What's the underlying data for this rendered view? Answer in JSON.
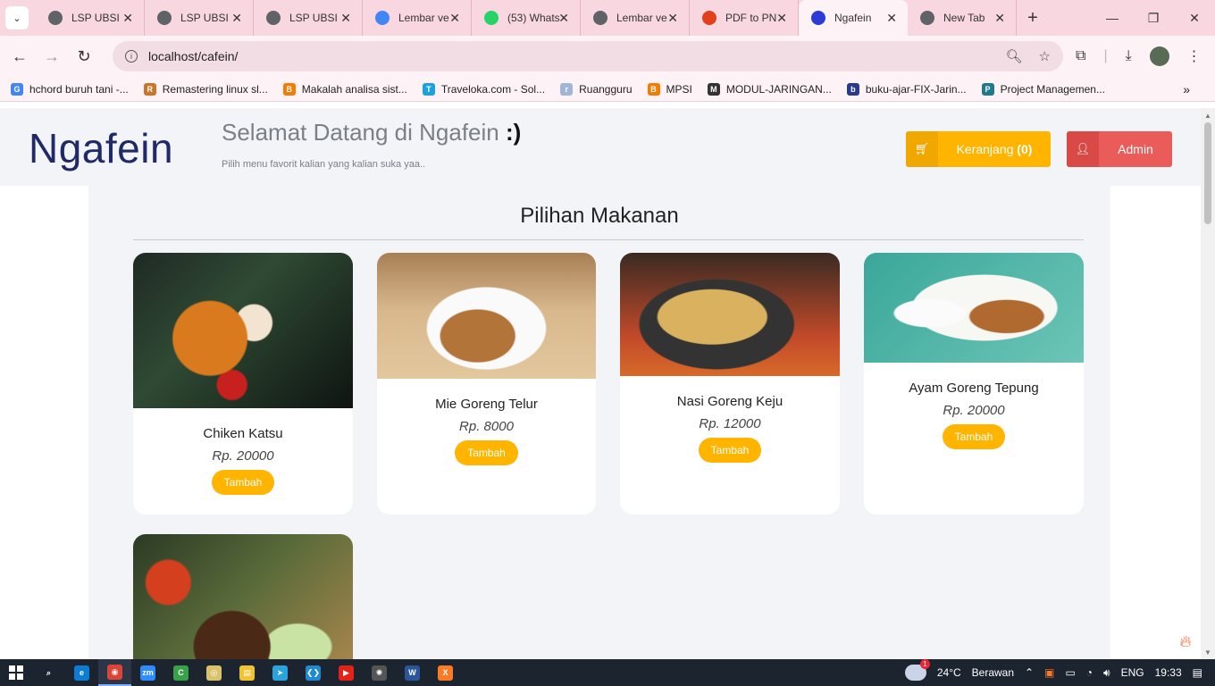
{
  "browser": {
    "tabs": [
      {
        "title": "LSP UBSI",
        "icon": "globe-icon",
        "color": "#5f6368"
      },
      {
        "title": "LSP UBSI",
        "icon": "globe-icon",
        "color": "#5f6368"
      },
      {
        "title": "LSP UBSI",
        "icon": "globe-icon",
        "color": "#5f6368"
      },
      {
        "title": "Lembar ve",
        "icon": "docs-icon",
        "color": "#4285f4"
      },
      {
        "title": "(53) Whats",
        "icon": "whatsapp-icon",
        "color": "#25d366"
      },
      {
        "title": "Lembar ve",
        "icon": "globe-icon",
        "color": "#5f6368"
      },
      {
        "title": "PDF to PN",
        "icon": "pdf-icon",
        "color": "#e2401c"
      },
      {
        "title": "Ngafein",
        "icon": "bootstrap-icon",
        "color": "#2a3bd8",
        "active": true
      },
      {
        "title": "New Tab",
        "icon": "chrome-icon",
        "color": "#5f6368"
      }
    ],
    "url": "localhost/cafein/",
    "bookmarks": [
      {
        "label": "hchord buruh tani -...",
        "color": "#4285f4",
        "glyph": "G"
      },
      {
        "label": "Remastering linux sl...",
        "color": "#c9762a",
        "glyph": "R"
      },
      {
        "label": "Makalah analisa sist...",
        "color": "#f57c00",
        "glyph": "B"
      },
      {
        "label": "Traveloka.com - Sol...",
        "color": "#1ba0e2",
        "glyph": "T"
      },
      {
        "label": "Ruangguru",
        "color": "#9fb6d8",
        "glyph": "r"
      },
      {
        "label": "MPSI",
        "color": "#f57c00",
        "glyph": "B"
      },
      {
        "label": "MODUL-JARINGAN...",
        "color": "#333333",
        "glyph": "M"
      },
      {
        "label": "buku-ajar-FIX-Jarin...",
        "color": "#2a3b8f",
        "glyph": "b"
      },
      {
        "label": "Project Managemen...",
        "color": "#1e7a8c",
        "glyph": "P"
      }
    ]
  },
  "site": {
    "brand": "Ngafein",
    "welcome": "Selamat Datang di Ngafein",
    "welcome_emote": ":)",
    "tagline": "Pilih menu favorit kalian yang kalian suka yaa..",
    "cart_label": "Keranjang",
    "cart_count": "(0)",
    "admin_label": "Admin",
    "section_title": "Pilihan Makanan",
    "add_label": "Tambah",
    "menu": [
      {
        "name": "Chiken Katsu",
        "price": "Rp. 20000",
        "image": "food-katsu"
      },
      {
        "name": "Mie Goreng Telur",
        "price": "Rp. 8000",
        "image": "food-mie"
      },
      {
        "name": "Nasi Goreng Keju",
        "price": "Rp. 12000",
        "image": "food-nasi"
      },
      {
        "name": "Ayam Goreng Tepung",
        "price": "Rp. 20000",
        "image": "food-ayam"
      },
      {
        "name": "",
        "price": "",
        "image": "food-sate"
      }
    ]
  },
  "taskbar": {
    "weather_temp": "24°C",
    "weather_text": "Berawan",
    "language": "ENG",
    "time": "19:33",
    "apps": [
      {
        "name": "search-app",
        "color": "transparent",
        "glyph": "⌕"
      },
      {
        "name": "edge-app",
        "color": "#0c7cd5",
        "glyph": "e"
      },
      {
        "name": "chrome-app",
        "color": "#db4437",
        "glyph": "◉"
      },
      {
        "name": "zoom-app",
        "color": "#2d8cff",
        "glyph": "zm"
      },
      {
        "name": "camtasia-app",
        "color": "#37a24a",
        "glyph": "C"
      },
      {
        "name": "media-app",
        "color": "#d8c36a",
        "glyph": "◎"
      },
      {
        "name": "explorer-app",
        "color": "#f1c232",
        "glyph": "▤"
      },
      {
        "name": "telegram-app",
        "color": "#2aa3df",
        "glyph": "➤"
      },
      {
        "name": "vscode-app",
        "color": "#1f8ad2",
        "glyph": "❮❯"
      },
      {
        "name": "youtube-app",
        "color": "#e62117",
        "glyph": "▶"
      },
      {
        "name": "chatgpt-app",
        "color": "#555555",
        "glyph": "✺"
      },
      {
        "name": "word-app",
        "color": "#2b579a",
        "glyph": "W"
      },
      {
        "name": "xampp-app",
        "color": "#fb7a24",
        "glyph": "X"
      }
    ]
  }
}
